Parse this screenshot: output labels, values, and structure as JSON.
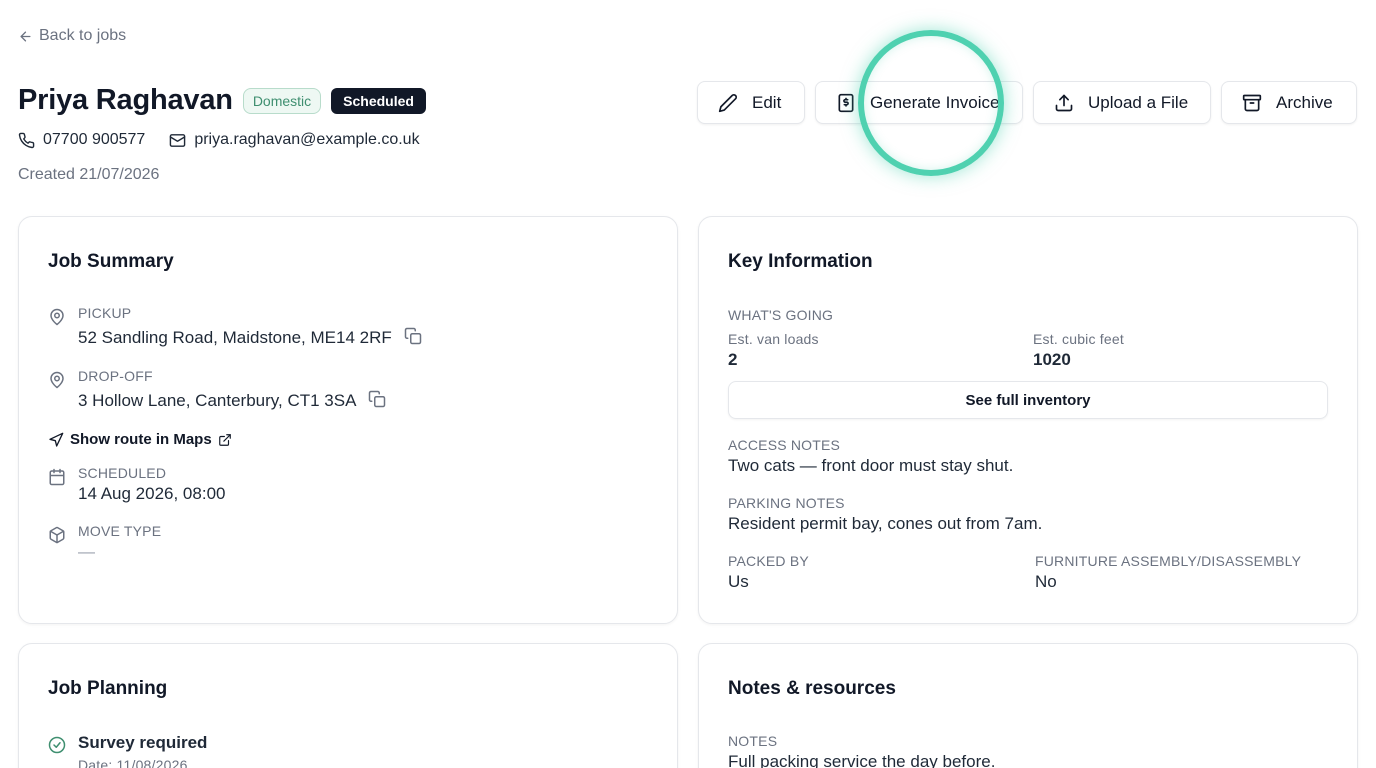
{
  "nav": {
    "back_label": "Back to jobs"
  },
  "header": {
    "name": "Priya Raghavan",
    "badge_type": "Domestic",
    "badge_status": "Scheduled",
    "phone": "07700 900577",
    "email": "priya.raghavan@example.co.uk",
    "created": "Created 21/07/2026"
  },
  "actions": {
    "edit": "Edit",
    "invoice": "Generate Invoice",
    "upload": "Upload a File",
    "archive": "Archive"
  },
  "job_summary": {
    "title": "Job Summary",
    "pickup_label": "PICKUP",
    "pickup_value": "52 Sandling Road, Maidstone, ME14 2RF",
    "dropoff_label": "DROP-OFF",
    "dropoff_value": "3 Hollow Lane, Canterbury, CT1 3SA",
    "route_label": "Show route in Maps",
    "scheduled_label": "SCHEDULED",
    "scheduled_value": "14 Aug 2026, 08:00",
    "movetype_label": "MOVE TYPE",
    "movetype_value": "—"
  },
  "key_info": {
    "title": "Key Information",
    "whats_going_label": "WHAT'S GOING",
    "van_loads_label": "Est. van loads",
    "van_loads_value": "2",
    "cubic_feet_label": "Est. cubic feet",
    "cubic_feet_value": "1020",
    "inventory_button": "See full inventory",
    "access_label": "ACCESS NOTES",
    "access_value": "Two cats — front door must stay shut.",
    "parking_label": "PARKING NOTES",
    "parking_value": "Resident permit bay, cones out from 7am.",
    "packed_label": "PACKED BY",
    "packed_value": "Us",
    "furniture_label": "FURNITURE ASSEMBLY/DISASSEMBLY",
    "furniture_value": "No"
  },
  "job_planning": {
    "title": "Job Planning",
    "survey_label": "Survey required",
    "survey_date": "Date: 11/08/2026"
  },
  "notes": {
    "title": "Notes & resources",
    "notes_label": "NOTES",
    "notes_value": "Full packing service the day before."
  },
  "colors": {
    "accent": "#4fd1b0",
    "badge_dark": "#111827",
    "badge_green": "#3f8f70"
  }
}
